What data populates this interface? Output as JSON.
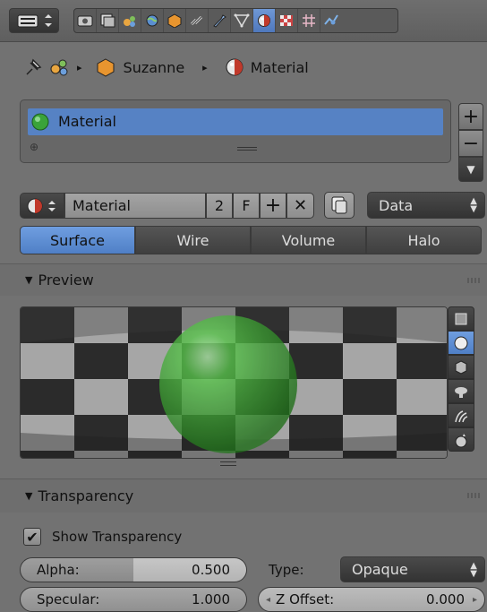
{
  "colors": {
    "accent": "#5682c4",
    "panel": "#727272",
    "button": "#9a9a9a",
    "dark_button": "#444444"
  },
  "header": {
    "editor_icon": "properties-editor-icon",
    "context_icons": [
      "render-icon",
      "render-layers-icon",
      "scene-icon",
      "world-icon",
      "object-icon",
      "constraints-icon",
      "modifiers-icon",
      "data-icon",
      "material-icon",
      "texture-icon",
      "particles-icon",
      "physics-icon"
    ],
    "active_context": "material-icon"
  },
  "breadcrumb": {
    "pin_icon": "pin-icon",
    "scene_icon": "scene-icon",
    "object_label": "Suzanne",
    "material_label": "Material"
  },
  "material_slots": {
    "items": [
      {
        "label": "Material"
      }
    ]
  },
  "datablock": {
    "name": "Material",
    "users": "2",
    "fake_user": "F",
    "link_mode": "Data"
  },
  "tabs": [
    {
      "label": "Surface",
      "selected": true
    },
    {
      "label": "Wire",
      "selected": false
    },
    {
      "label": "Volume",
      "selected": false
    },
    {
      "label": "Halo",
      "selected": false
    }
  ],
  "preview_panel": {
    "title": "Preview",
    "shapes": [
      "flat-plane-icon",
      "sphere-icon",
      "cube-icon",
      "monkey-icon",
      "hair-icon",
      "sphere-sky-icon"
    ],
    "selected_shape": "sphere-icon"
  },
  "transparency_panel": {
    "title": "Transparency",
    "show_transparency_label": "Show Transparency",
    "show_transparency": true,
    "alpha_label": "Alpha:",
    "alpha_value": "0.500",
    "specular_label": "Specular:",
    "specular_value": "1.000",
    "type_label": "Type:",
    "type_value": "Opaque",
    "z_offset_label": "Z Offset:",
    "z_offset_value": "0.000"
  }
}
